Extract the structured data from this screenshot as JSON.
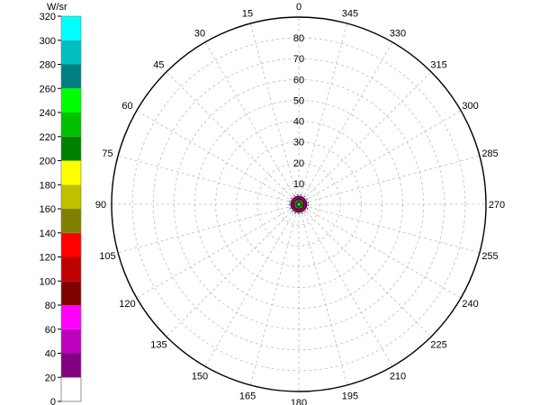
{
  "chart_data": {
    "type": "polar-contour",
    "title": "",
    "colorbar": {
      "unit": "W/sr",
      "ticks": [
        0,
        20,
        40,
        60,
        80,
        100,
        120,
        140,
        160,
        180,
        200,
        220,
        240,
        260,
        280,
        300,
        320
      ],
      "colors": [
        "#ffffff",
        "#800080",
        "#c000c0",
        "#ff00ff",
        "#800000",
        "#c00000",
        "#ff0000",
        "#808000",
        "#c0c000",
        "#ffff00",
        "#008000",
        "#00c000",
        "#00ff00",
        "#008080",
        "#00c0c0",
        "#00ffff"
      ]
    },
    "angle_labels": [
      0,
      15,
      30,
      45,
      60,
      75,
      90,
      105,
      120,
      135,
      150,
      165,
      180,
      195,
      210,
      225,
      240,
      255,
      270,
      285,
      300,
      315,
      330,
      345
    ],
    "angle_direction": "counterclockwise",
    "radial_labels": [
      10,
      20,
      30,
      40,
      50,
      60,
      70,
      80
    ],
    "radial_range": [
      0,
      90
    ],
    "grid": true,
    "contours": [
      {
        "level_min": 0,
        "level_max": 20,
        "radius": 4.0,
        "color": "#800080"
      },
      {
        "level_min": 20,
        "level_max": 40,
        "radius": 3.6,
        "color": "#c000c0"
      },
      {
        "level_min": 40,
        "level_max": 60,
        "radius": 3.2,
        "color": "#ff00ff"
      },
      {
        "level_min": 80,
        "level_max": 100,
        "radius": 2.8,
        "color": "#800000"
      },
      {
        "level_min": 120,
        "level_max": 140,
        "radius": 2.5,
        "color": "#ff0000"
      },
      {
        "level_min": 160,
        "level_max": 180,
        "radius": 2.2,
        "color": "#c0c000"
      },
      {
        "level_min": 180,
        "level_max": 200,
        "radius": 1.9,
        "color": "#ffff00"
      },
      {
        "level_min": 200,
        "level_max": 220,
        "radius": 1.6,
        "color": "#008000"
      },
      {
        "level_min": 240,
        "level_max": 260,
        "radius": 1.3,
        "color": "#00ff00"
      },
      {
        "level_min": 260,
        "level_max": 280,
        "radius": 1.0,
        "color": "#008080"
      },
      {
        "level_min": 300,
        "level_max": 320,
        "radius": 0.7,
        "color": "#00ffff"
      }
    ]
  }
}
